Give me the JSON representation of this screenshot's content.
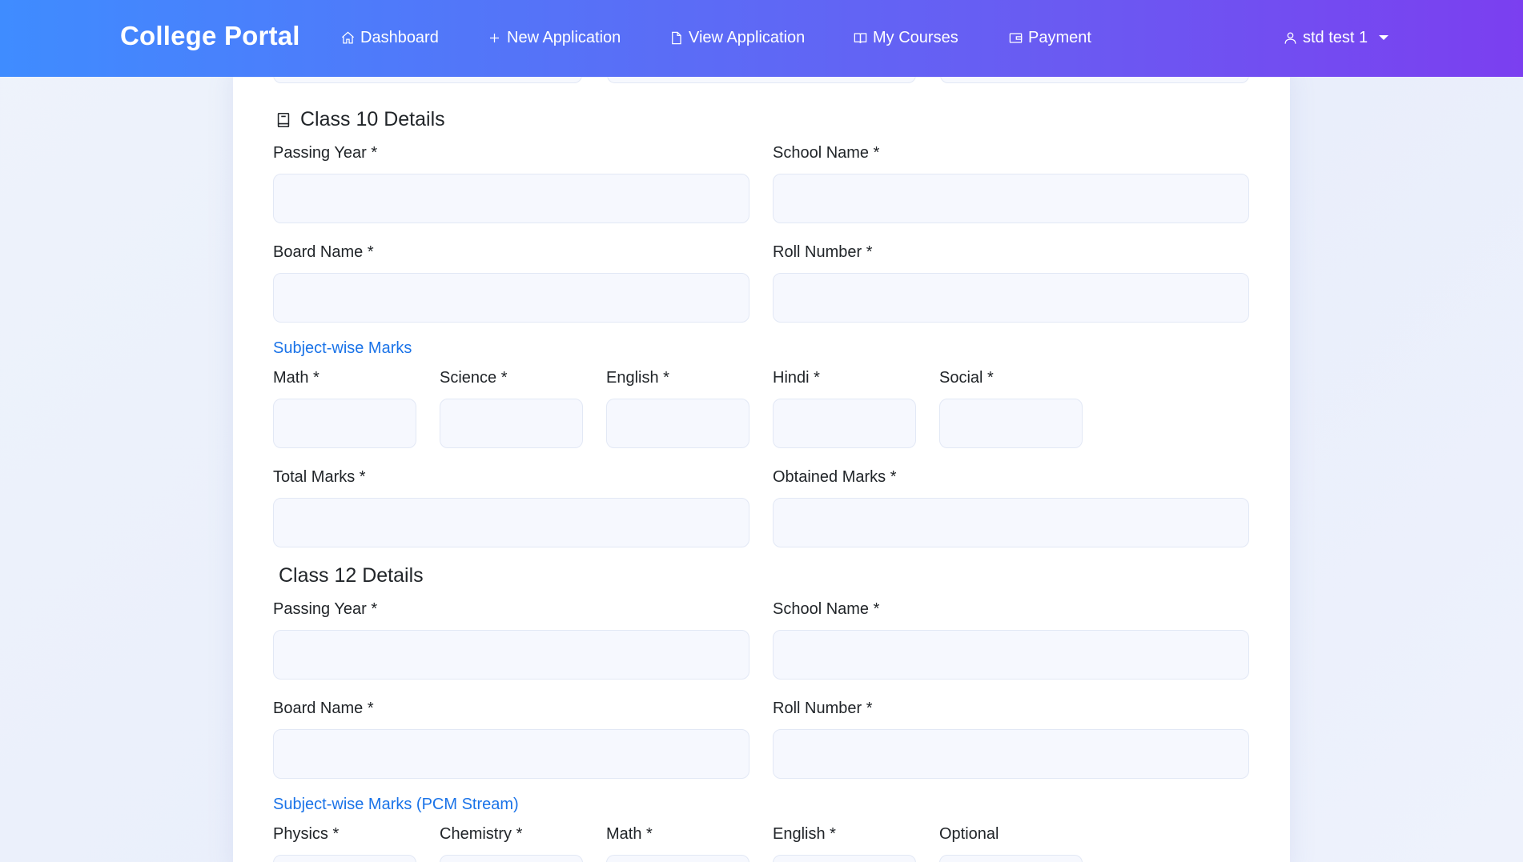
{
  "navbar": {
    "brand": "College Portal",
    "items": [
      {
        "label": "Dashboard",
        "icon": "home-icon"
      },
      {
        "label": "New Application",
        "icon": "plus-icon"
      },
      {
        "label": "View Application",
        "icon": "file-icon"
      },
      {
        "label": "My Courses",
        "icon": "book-open-icon"
      },
      {
        "label": "Payment",
        "icon": "wallet-icon"
      }
    ],
    "user": {
      "label": "std test 1",
      "icon": "user-icon"
    }
  },
  "class10": {
    "title": "Class 10 Details",
    "icon": "book-icon",
    "passing_year": "Passing Year *",
    "school_name": "School Name *",
    "board_name": "Board Name *",
    "roll_number": "Roll Number *",
    "marks_title": "Subject-wise Marks",
    "subjects": [
      "Math *",
      "Science *",
      "English *",
      "Hindi *",
      "Social *"
    ],
    "total_marks": "Total Marks *",
    "obtained_marks": "Obtained Marks *"
  },
  "class12": {
    "title": "Class 12 Details",
    "passing_year": "Passing Year *",
    "school_name": "School Name *",
    "board_name": "Board Name *",
    "roll_number": "Roll Number *",
    "marks_title": "Subject-wise Marks (PCM Stream)",
    "subjects": [
      "Physics *",
      "Chemistry *",
      "Math *",
      "English *",
      "Optional"
    ]
  },
  "colors": {
    "nav_start": "#3f8cff",
    "nav_end": "#7b3ff0",
    "accent_link": "#1a73e8",
    "input_bg": "#f6f8fe"
  }
}
